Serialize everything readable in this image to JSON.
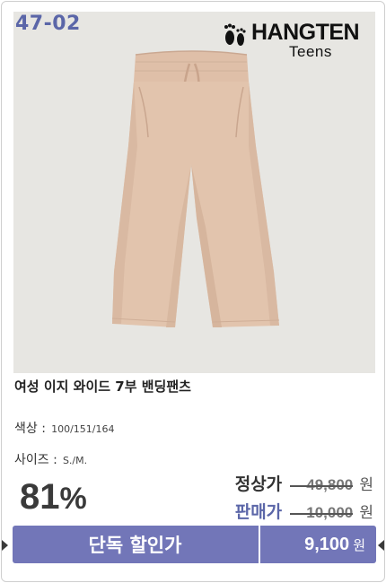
{
  "product": {
    "code": "47-02",
    "brand": "HANGTEN",
    "brand_sub": "Teens",
    "title": "여성 이지 와이드 7부 밴딩팬츠"
  },
  "meta": {
    "color_label": "색상 :",
    "color_value": "100/151/164",
    "size_label": "사이즈 :",
    "size_value": "S./M."
  },
  "discount": {
    "value": "81",
    "unit": "%"
  },
  "prices": {
    "regular_label": "정상가",
    "regular_value": "49,800",
    "sale_label": "판매가",
    "sale_value": "10,000",
    "currency": "원"
  },
  "promo_bar": {
    "label": "단독 할인가",
    "price": "9,100",
    "currency": "원"
  },
  "colors": {
    "accent": "#7276b8",
    "code_color": "#5b66a8",
    "regular_label_color": "#333333",
    "sale_label_color": "#5b66a8",
    "photo_bg": "#e7e6e2",
    "product_color": "#e2c4ad"
  },
  "icons": {
    "brand_mark": "footprints-icon"
  }
}
